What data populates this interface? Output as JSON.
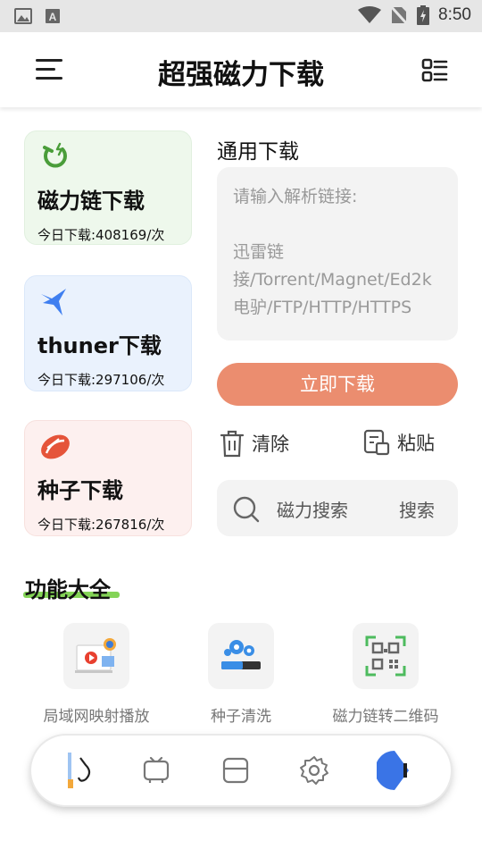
{
  "status_bar": {
    "time": "8:50"
  },
  "app_bar": {
    "title": "超强磁力下载"
  },
  "cards": [
    {
      "title": "磁力链下载",
      "count": "今日下载:408169/次",
      "icon": "magnet-icon"
    },
    {
      "title": "thuner下载",
      "count": "今日下载:297106/次",
      "icon": "bird-icon"
    },
    {
      "title": "种子下载",
      "count": "今日下载:267816/次",
      "icon": "seed-icon"
    }
  ],
  "general_download": {
    "title": "通用下载",
    "placeholder_line1": "请输入解析链接:",
    "placeholder_line2": "迅雷链接/Torrent/Magnet/Ed2k电驴/FTP/HTTP/HTTPS",
    "button": "立即下载",
    "clear": "清除",
    "paste": "粘贴"
  },
  "search": {
    "placeholder": "磁力搜索",
    "button": "搜索"
  },
  "features": {
    "title": "功能大全",
    "items": [
      {
        "label": "局域网映射播放",
        "icon": "screen-cast-icon"
      },
      {
        "label": "种子清洗",
        "icon": "gears-icon"
      },
      {
        "label": "磁力链转二维码",
        "icon": "qr-code-icon"
      }
    ]
  },
  "colors": {
    "accent": "#eb8d6f",
    "underline": "#6fcc3a",
    "card_magnet_bg": "#eef8ec",
    "card_thuner_bg": "#eaf2fd",
    "card_seed_bg": "#fdf0ef"
  }
}
